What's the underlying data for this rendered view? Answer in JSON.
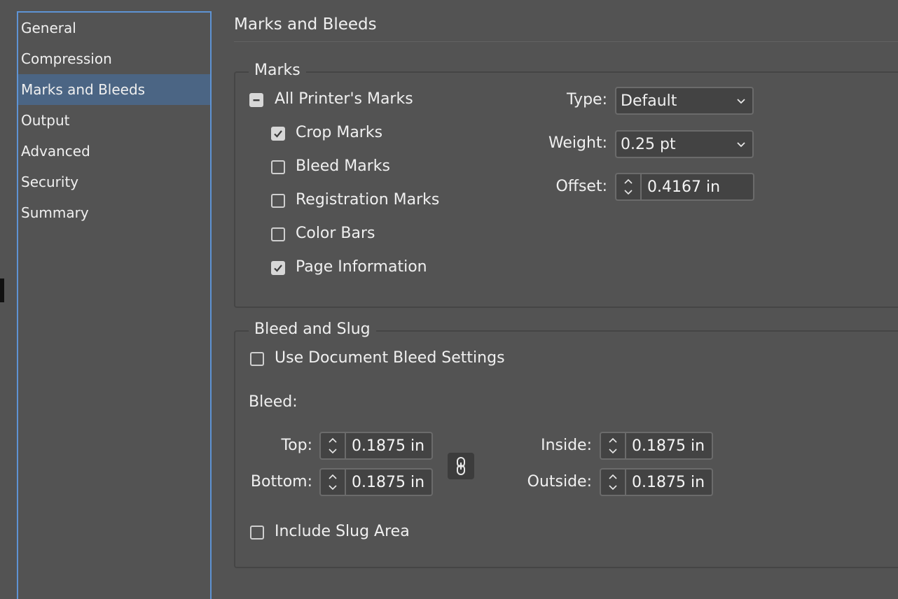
{
  "sidebar": {
    "items": [
      {
        "label": "General"
      },
      {
        "label": "Compression"
      },
      {
        "label": "Marks and Bleeds"
      },
      {
        "label": "Output"
      },
      {
        "label": "Advanced"
      },
      {
        "label": "Security"
      },
      {
        "label": "Summary"
      }
    ],
    "selected": "Marks and Bleeds"
  },
  "main": {
    "title": "Marks and Bleeds",
    "marks": {
      "legend": "Marks",
      "all_printers_marks": {
        "label": "All Printer's Marks",
        "state": "mixed"
      },
      "crop_marks": {
        "label": "Crop Marks",
        "checked": true
      },
      "bleed_marks": {
        "label": "Bleed Marks",
        "checked": false
      },
      "registration_marks": {
        "label": "Registration Marks",
        "checked": false
      },
      "color_bars": {
        "label": "Color Bars",
        "checked": false
      },
      "page_information": {
        "label": "Page Information",
        "checked": true
      },
      "type": {
        "label": "Type:",
        "value": "Default"
      },
      "weight": {
        "label": "Weight:",
        "value": "0.25 pt"
      },
      "offset": {
        "label": "Offset:",
        "value": "0.4167 in"
      }
    },
    "bleed_slug": {
      "legend": "Bleed and Slug",
      "use_document_bleed": {
        "label": "Use Document Bleed Settings",
        "checked": false
      },
      "bleed_label": "Bleed:",
      "top": {
        "label": "Top:",
        "value": "0.1875 in"
      },
      "bottom": {
        "label": "Bottom:",
        "value": "0.1875 in"
      },
      "inside": {
        "label": "Inside:",
        "value": "0.1875 in"
      },
      "outside": {
        "label": "Outside:",
        "value": "0.1875 in"
      },
      "include_slug": {
        "label": "Include Slug Area",
        "checked": false
      }
    }
  },
  "colors": {
    "background": "#535353",
    "sidebar_border": "#5e93d4",
    "selection": "#4b6584",
    "field_bg": "#434343"
  }
}
